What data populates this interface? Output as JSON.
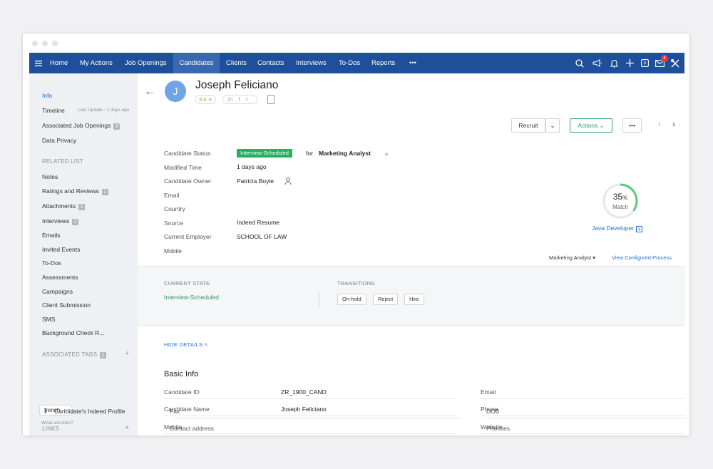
{
  "navbar": {
    "items": [
      "Home",
      "My Actions",
      "Job Openings",
      "Candidates",
      "Clients",
      "Contacts",
      "Interviews",
      "To-Dos",
      "Reports",
      "•••"
    ],
    "active": "Candidates",
    "notification_count": "4",
    "accent_color": "#1f4e9b"
  },
  "sidebar": {
    "info": "Info",
    "timeline": "Timeline",
    "last_update": "Last Update : 1 days ago",
    "associated_jobs": "Associated Job Openings",
    "associated_jobs_count": "2",
    "data_privacy": "Data Privacy",
    "related_list_head": "RELATED LIST",
    "related": [
      {
        "label": "Notes",
        "count": ""
      },
      {
        "label": "Ratings and Reviews",
        "count": "1"
      },
      {
        "label": "Attachments",
        "count": "1"
      },
      {
        "label": "Interviews",
        "count": "2"
      },
      {
        "label": "Emails",
        "count": ""
      },
      {
        "label": "Invited Events",
        "count": ""
      },
      {
        "label": "To-Dos",
        "count": ""
      },
      {
        "label": "Assessments",
        "count": ""
      },
      {
        "label": "Campaigns",
        "count": ""
      },
      {
        "label": "Client Submission",
        "count": ""
      },
      {
        "label": "SMS",
        "count": ""
      },
      {
        "label": "Background Check R...",
        "count": ""
      }
    ],
    "tags_head": "ASSOCIATED TAGS",
    "tags_count": "1",
    "tag": "french",
    "links_head": "LINKS",
    "link": "Candidate's Indeed Profile",
    "links_help": "What are links?"
  },
  "candidate": {
    "initial": "J",
    "name": "Joseph Feliciano",
    "rating": "3.0",
    "social": [
      "in",
      "f",
      "t"
    ]
  },
  "header_buttons": {
    "recruit": "Recruit",
    "actions": "Actions",
    "more": "•••"
  },
  "fields": {
    "status_label": "Candidate Status",
    "status_value": "Interview-Scheduled",
    "status_for": "for",
    "status_job": "Marketing Analyst",
    "modified_label": "Modified Time",
    "modified_value": "1 days ago",
    "owner_label": "Candidate Owner",
    "owner_value": "Patricia Boyle",
    "email_label": "Email",
    "country_label": "Country",
    "source_label": "Source",
    "source_value": "Indeed Resume",
    "employer_label": "Current Employer",
    "employer_value": "SCHOOL OF LAW",
    "mobile_label": "Mobile"
  },
  "match": {
    "percent": 35,
    "percent_text": "35",
    "percent_sign": "%",
    "label": "Match",
    "job_link": "Java Developer",
    "ring_color": "#5cc97a"
  },
  "process": {
    "selected": "Marketing Analyst",
    "view_link": "View Configured Process"
  },
  "state": {
    "current_head": "CURRENT STATE",
    "current_value": "Interview-Scheduled",
    "transitions_head": "TRANSITIONS",
    "transitions": [
      "On-hold",
      "Reject",
      "Hire"
    ]
  },
  "details": {
    "hide_label": "HIDE DETAILS",
    "section_title": "Basic Info",
    "left": [
      {
        "label": "Candidate ID",
        "value": "ZR_1900_CAND"
      },
      {
        "label": "Candidate Name",
        "value": "Joseph Feliciano"
      },
      {
        "label": "Mobile",
        "value": ""
      },
      {
        "label": "Fax",
        "value": ""
      },
      {
        "label": "Contact address",
        "value": ""
      }
    ],
    "right": [
      "Email",
      "Phone",
      "Website",
      "DOB",
      "Priorities"
    ]
  }
}
